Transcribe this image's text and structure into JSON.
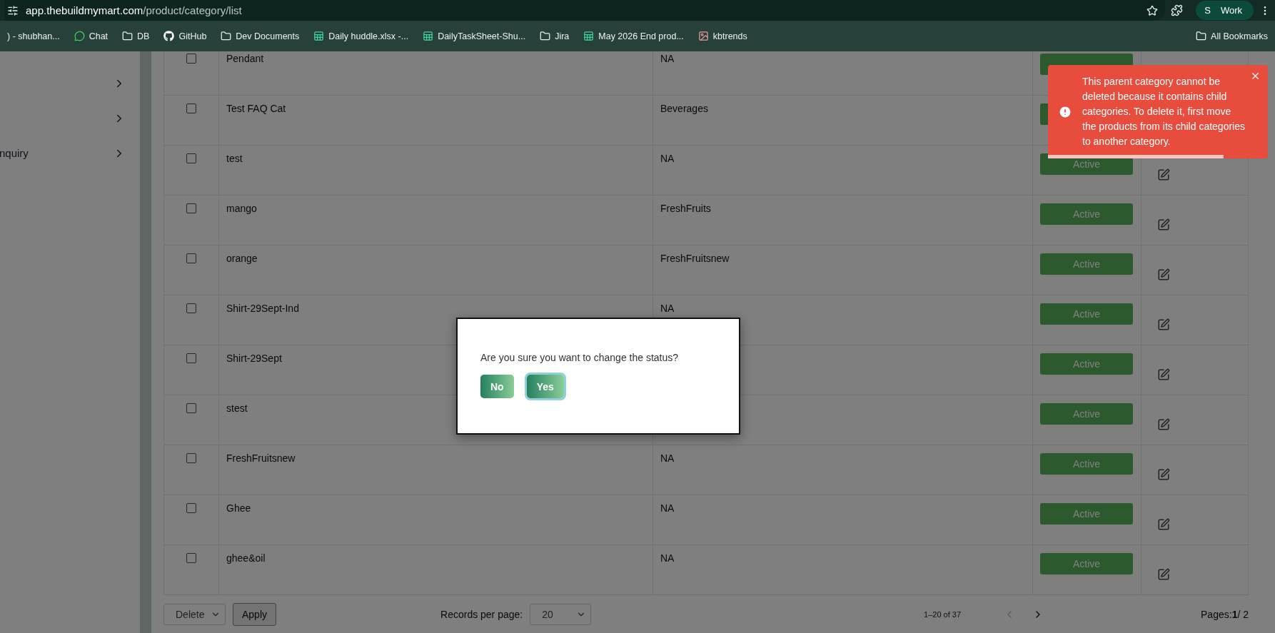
{
  "browser": {
    "url_host": "app.thebuildmymart.com",
    "url_path": "/product/category/list",
    "profile_initial": "S",
    "profile_name": "Work"
  },
  "bookmarks": [
    {
      "label": ") - shubhan...",
      "kind": "plain"
    },
    {
      "label": "Chat",
      "kind": "chat"
    },
    {
      "label": "DB",
      "kind": "folder"
    },
    {
      "label": "GitHub",
      "kind": "github"
    },
    {
      "label": "Dev Documents",
      "kind": "folder"
    },
    {
      "label": "Daily huddle.xlsx -...",
      "kind": "sheet"
    },
    {
      "label": "DailyTaskSheet-Shu...",
      "kind": "sheet"
    },
    {
      "label": "Jira",
      "kind": "folder"
    },
    {
      "label": "May 2026 End prod...",
      "kind": "sheet"
    },
    {
      "label": "kbtrends",
      "kind": "image"
    }
  ],
  "all_bookmarks": "All Bookmarks",
  "sidebar": {
    "items": [
      {
        "expandable": true
      },
      {
        "expandable": true
      },
      {
        "label": "nquiry",
        "expandable": true
      }
    ]
  },
  "table": {
    "rows": [
      {
        "name": "Pendant",
        "parent": "NA",
        "checked": false
      },
      {
        "name": "Test FAQ Cat",
        "parent": "Beverages",
        "checked": false
      },
      {
        "name": "test",
        "parent": "NA",
        "status": "Active",
        "checked": false
      },
      {
        "name": "mango",
        "parent": "FreshFruits",
        "status": "Active",
        "checked": false
      },
      {
        "name": "orange",
        "parent": "FreshFruitsnew",
        "status": "Active",
        "checked": false
      },
      {
        "name": "Shirt-29Sept-Ind",
        "parent": "NA",
        "status": "Active",
        "checked": false
      },
      {
        "name": "Shirt-29Sept",
        "status": "Active",
        "checked": false
      },
      {
        "name": "stest",
        "status": "Active",
        "checked": false
      },
      {
        "name": "FreshFruitsnew",
        "parent": "NA",
        "status": "Active",
        "checked": false
      },
      {
        "name": "Ghee",
        "parent": "NA",
        "status": "Active",
        "checked": false
      },
      {
        "name": "ghee&oil",
        "parent": "NA",
        "status": "Active",
        "checked": false
      }
    ]
  },
  "footer": {
    "bulk_action": "Delete",
    "apply": "Apply",
    "records_label": "Records per page:",
    "records_value": "20",
    "range": "1–20 of 37",
    "prev_disabled": true,
    "pages": "Pages:**1**/ 2"
  },
  "dialog": {
    "message": "Are you sure you want to change the status?",
    "buttons": [
      {
        "label": "No",
        "focused": false
      },
      {
        "label": "Yes",
        "focused": true
      }
    ]
  },
  "toast": {
    "message": "This parent category cannot be deleted because it contains child categories. To delete it, first move the products from its child categories to another category.",
    "level": 0.8
  }
}
